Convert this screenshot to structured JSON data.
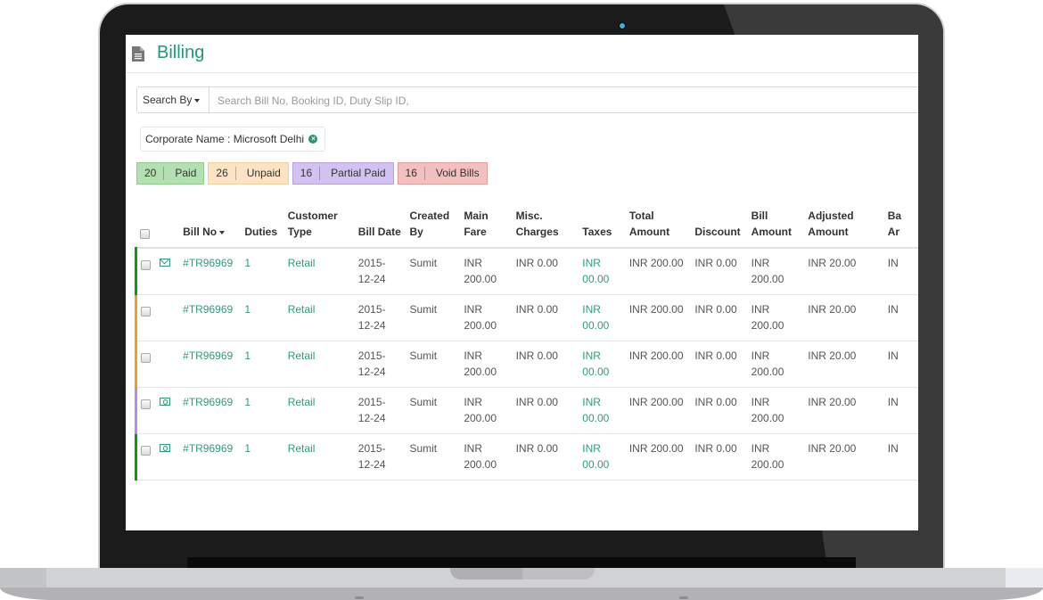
{
  "header": {
    "title": "Billing",
    "icon": "document-icon"
  },
  "search": {
    "search_by_label": "Search By",
    "placeholder": "Search Bill No, Booking ID, Duty Slip ID,",
    "value": ""
  },
  "filters": [
    {
      "label": "Corporate Name : Microsoft Delhi",
      "icon": "close-circle-icon"
    }
  ],
  "status_counts": [
    {
      "count": "20",
      "label": "Paid",
      "color": "#b3e0b0"
    },
    {
      "count": "26",
      "label": "Unpaid",
      "color": "#fbe3c3"
    },
    {
      "count": "16",
      "label": "Partial Paid",
      "color": "#d3c2ef"
    },
    {
      "count": "16",
      "label": "Void Bills",
      "color": "#f2c1bf"
    }
  ],
  "table": {
    "columns": [
      {
        "l1": "",
        "l2": "Bill No"
      },
      {
        "l1": "",
        "l2": "Duties"
      },
      {
        "l1": "Customer",
        "l2": "Type"
      },
      {
        "l1": "",
        "l2": "Bill Date"
      },
      {
        "l1": "Created",
        "l2": "By"
      },
      {
        "l1": "Main",
        "l2": "Fare"
      },
      {
        "l1": "Misc.",
        "l2": "Charges"
      },
      {
        "l1": "",
        "l2": "Taxes"
      },
      {
        "l1": "Total",
        "l2": "Amount"
      },
      {
        "l1": "",
        "l2": "Discount"
      },
      {
        "l1": "Bill",
        "l2": "Amount"
      },
      {
        "l1": "Adjusted",
        "l2": "Amount"
      },
      {
        "l1": "Ba",
        "l2": "Ar"
      }
    ],
    "rows": [
      {
        "status_color": "#0a9a0a",
        "icon": "mail-icon",
        "bill_no": "#TR96969",
        "duties": "1",
        "customer_type": "Retail",
        "bill_date": "2015-12-24",
        "created_by": "Sumit",
        "main_fare": "INR 200.00",
        "misc_charges": "INR 0.00",
        "taxes": "INR 00.00",
        "total_amount": "INR 200.00",
        "discount": "INR 0.00",
        "bill_amount": "INR 200.00",
        "adjusted_amount": "INR 20.00",
        "balance": "IN"
      },
      {
        "status_color": "#f0a020",
        "icon": "",
        "bill_no": "#TR96969",
        "duties": "1",
        "customer_type": "Retail",
        "bill_date": "2015-12-24",
        "created_by": "Sumit",
        "main_fare": "INR 200.00",
        "misc_charges": "INR 0.00",
        "taxes": "INR 00.00",
        "total_amount": "INR 200.00",
        "discount": "INR 0.00",
        "bill_amount": "INR 200.00",
        "adjusted_amount": "INR 20.00",
        "balance": "IN"
      },
      {
        "status_color": "#f0a020",
        "icon": "",
        "bill_no": "#TR96969",
        "duties": "1",
        "customer_type": "Retail",
        "bill_date": "2015-12-24",
        "created_by": "Sumit",
        "main_fare": "INR 200.00",
        "misc_charges": "INR 0.00",
        "taxes": "INR 00.00",
        "total_amount": "INR 200.00",
        "discount": "INR 0.00",
        "bill_amount": "INR 200.00",
        "adjusted_amount": "INR 20.00",
        "balance": "IN"
      },
      {
        "status_color": "#b58ee8",
        "icon": "money-icon",
        "bill_no": "#TR96969",
        "duties": "1",
        "customer_type": "Retail",
        "bill_date": "2015-12-24",
        "created_by": "Sumit",
        "main_fare": "INR 200.00",
        "misc_charges": "INR 0.00",
        "taxes": "INR 00.00",
        "total_amount": "INR 200.00",
        "discount": "INR 0.00",
        "bill_amount": "INR 200.00",
        "adjusted_amount": "INR 20.00",
        "balance": "IN"
      },
      {
        "status_color": "#0a9a0a",
        "icon": "money-icon",
        "bill_no": "#TR96969",
        "duties": "1",
        "customer_type": "Retail",
        "bill_date": "2015-12-24",
        "created_by": "Sumit",
        "main_fare": "INR 200.00",
        "misc_charges": "INR 0.00",
        "taxes": "INR 00.00",
        "total_amount": "INR 200.00",
        "discount": "INR 0.00",
        "bill_amount": "INR 200.00",
        "adjusted_amount": "INR 20.00",
        "balance": "IN"
      }
    ]
  },
  "colors": {
    "accent": "#1e9a7a",
    "link": "#2a9d7e"
  }
}
